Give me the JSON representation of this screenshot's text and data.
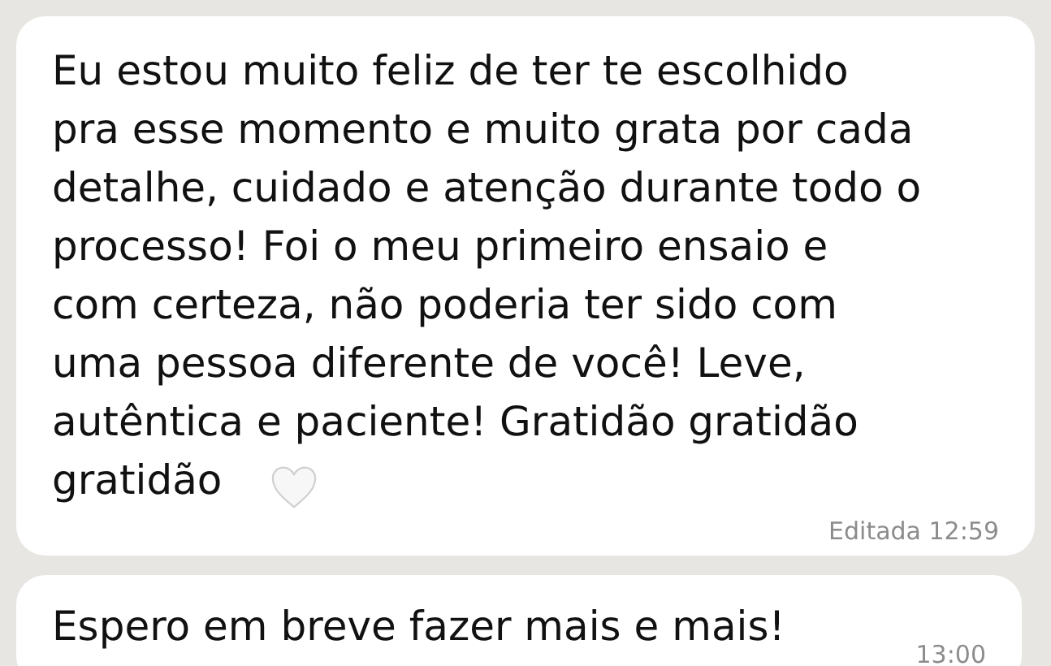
{
  "messages": [
    {
      "text": "Eu estou muito feliz de ter te escolhido\npra esse momento e muito grata por cada\ndetalhe, cuidado e atenção durante todo o\nprocesso! Foi o meu primeiro ensaio e\ncom certeza, não poderia ter sido com\numa pessoa diferente de você! Leve,\nautêntica e paciente! Gratidão gratidão\ngratidão",
      "heart": true,
      "edited": "Editada",
      "time": "12:59"
    },
    {
      "text": "Espero em breve fazer mais e mais!",
      "heart": false,
      "time": "13:00"
    }
  ]
}
